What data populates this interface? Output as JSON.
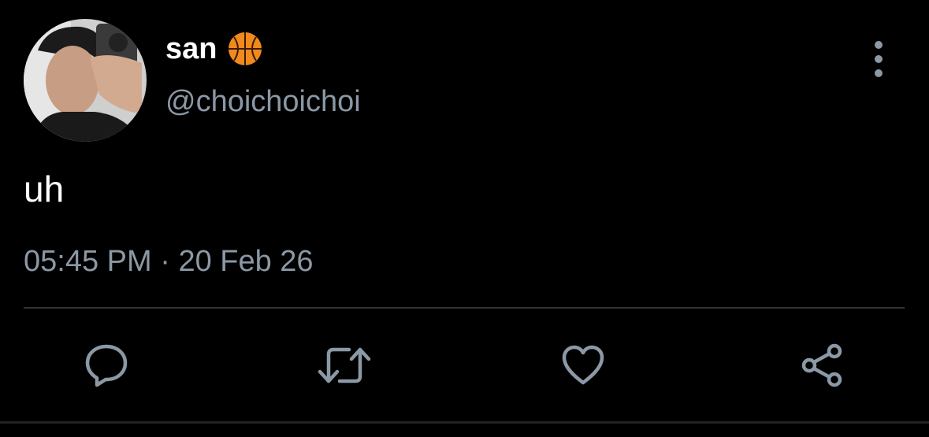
{
  "user": {
    "display_name": "san",
    "badge_icon": "basketball-icon",
    "handle": "@choichoichoi"
  },
  "tweet": {
    "text": "uh",
    "time": "05:45 PM",
    "separator": "·",
    "date": "20 Feb 26"
  },
  "actions": [
    {
      "name": "reply",
      "icon": "comment-icon"
    },
    {
      "name": "retweet",
      "icon": "retweet-icon"
    },
    {
      "name": "like",
      "icon": "heart-icon"
    },
    {
      "name": "share",
      "icon": "share-icon"
    }
  ],
  "colors": {
    "background": "#000000",
    "primary_text": "#ffffff",
    "secondary_text": "#8b98a5",
    "divider": "#2f3336",
    "icon": "#8b98a5"
  }
}
